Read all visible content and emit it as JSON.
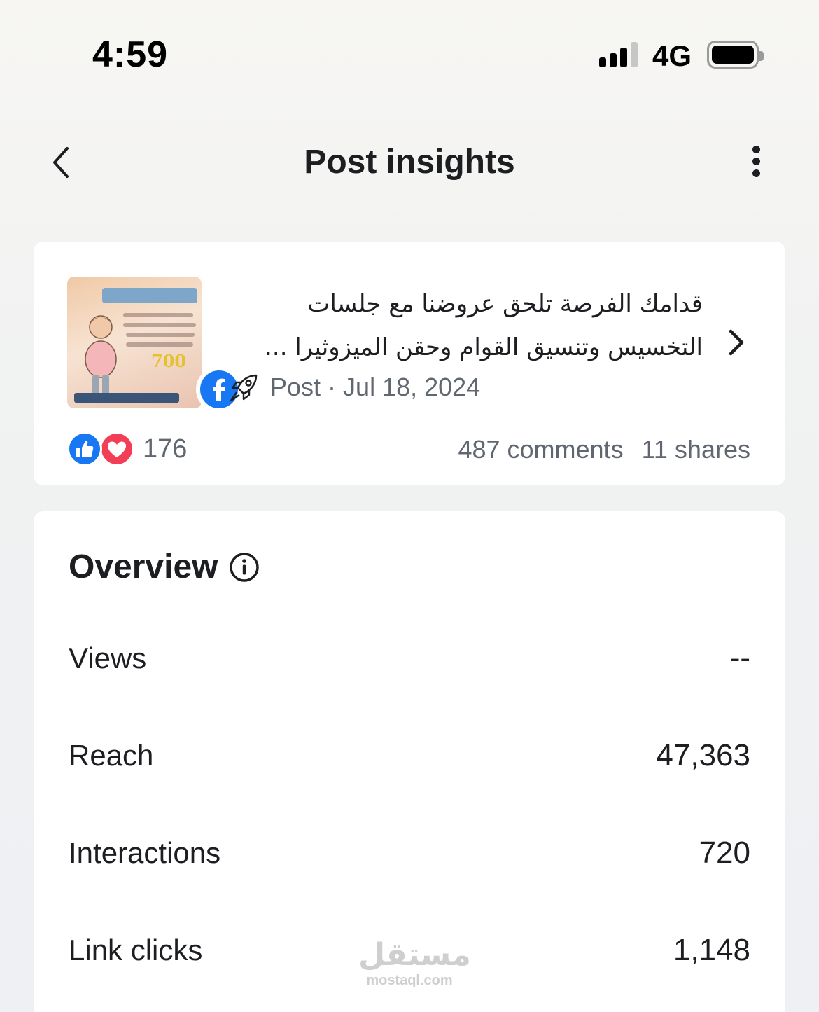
{
  "status_bar": {
    "time": "4:59",
    "network": "4G",
    "signal_bars": 3,
    "battery_level": 1.0
  },
  "header": {
    "title": "Post insights",
    "back_icon": "chevron-left-icon",
    "more_icon": "more-vertical-icon"
  },
  "post": {
    "text_line1": "قدامك الفرصة تلحق عروضنا مع جلسات",
    "text_line2": "التخسيس وتنسيق القوام وحقن الميزوثيرا ...",
    "type": "Post",
    "separator": "·",
    "date": "Jul 18, 2024",
    "thumbnail_price": "700",
    "platform_icon": "facebook-icon",
    "reactions_count": "176",
    "comments": "487 comments",
    "shares": "11 shares"
  },
  "overview": {
    "title": "Overview",
    "metrics": [
      {
        "label": "Views",
        "value": "--"
      },
      {
        "label": "Reach",
        "value": "47,363"
      },
      {
        "label": "Interactions",
        "value": "720"
      },
      {
        "label": "Link clicks",
        "value": "1,148"
      }
    ]
  },
  "watermark": {
    "arabic": "مستقل",
    "latin": "mostaql.com"
  },
  "colors": {
    "facebook_blue": "#1877f2",
    "love_red": "#f33e58",
    "text_primary": "#1c1e21",
    "text_secondary": "#606770"
  }
}
